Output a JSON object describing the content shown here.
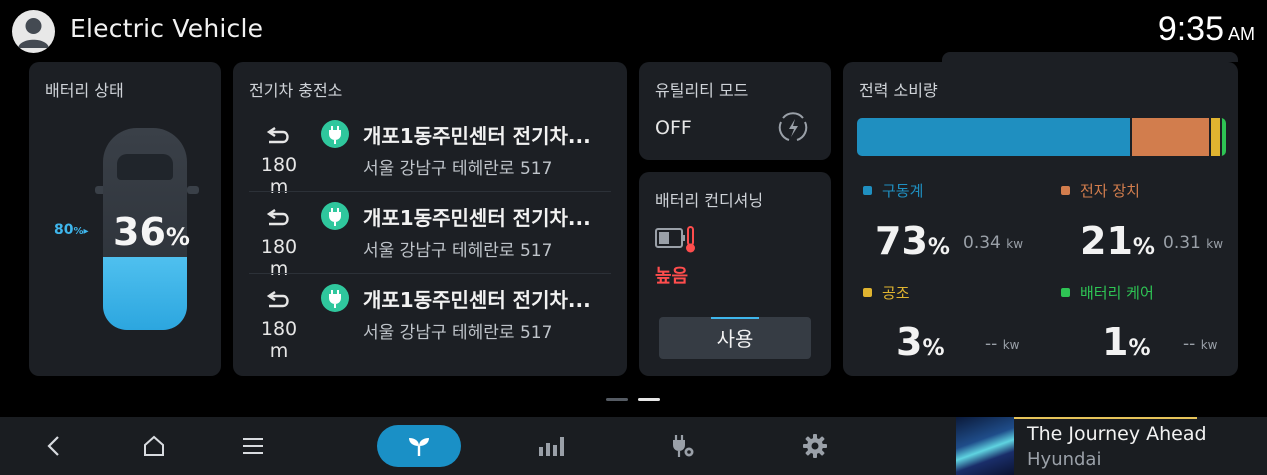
{
  "header": {
    "title": "Electric Vehicle",
    "time": "9:35",
    "ampm": "AM"
  },
  "battery": {
    "title": "배터리 상태",
    "charge_limit": "80",
    "charge_limit_unit": "%",
    "soc": "36",
    "soc_unit": "%",
    "soc_fraction": 0.36
  },
  "charging": {
    "title": "전기차 충전소",
    "stations": [
      {
        "name": "개포1동주민센터 전기차...",
        "address": "서울 강남구 테헤란로 517",
        "distance": "180 m"
      },
      {
        "name": "개포1동주민센터 전기차...",
        "address": "서울 강남구 테헤란로 517",
        "distance": "180 m"
      },
      {
        "name": "개포1동주민센터 전기차...",
        "address": "서울 강남구 테헤란로 517",
        "distance": "180 m"
      }
    ]
  },
  "utility": {
    "title": "유틸리티 모드",
    "state": "OFF"
  },
  "conditioning": {
    "title": "배터리 컨디셔닝",
    "status": "높음",
    "button": "사용"
  },
  "power": {
    "title": "전력 소비량",
    "items": [
      {
        "label": "구동계",
        "percent": "73",
        "kw": "0.34",
        "color": "#1f8fc0"
      },
      {
        "label": "전자 장치",
        "percent": "21",
        "kw": "0.31",
        "color": "#d27d4d"
      },
      {
        "label": "공조",
        "percent": "3",
        "kw": "--",
        "color": "#e0b430"
      },
      {
        "label": "배터리 케어",
        "percent": "1",
        "kw": "--",
        "color": "#2ec454"
      }
    ],
    "pct_unit": "%",
    "kw_unit": "kw"
  },
  "pager": {
    "pages": 2,
    "current": 2
  },
  "nav": {
    "items": [
      "back-icon",
      "home-icon",
      "menu-icon",
      "leaf-icon",
      "bar-chart-icon",
      "charging-settings-icon",
      "gear-icon"
    ],
    "active": "leaf-icon",
    "accent": "#1a90c6"
  },
  "media": {
    "track": "The Journey Ahead",
    "artist": "Hyundai"
  }
}
